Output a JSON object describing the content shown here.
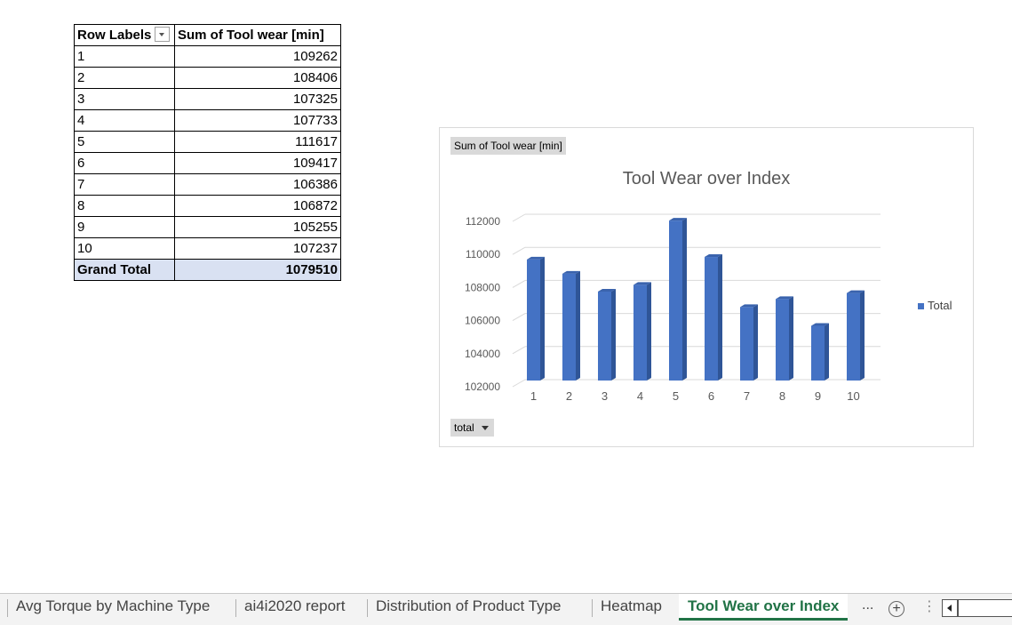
{
  "pivot": {
    "header_row_labels": "Row Labels",
    "header_sum": "Sum of Tool wear [min]",
    "rows": [
      {
        "label": "1",
        "value": "109262"
      },
      {
        "label": "2",
        "value": "108406"
      },
      {
        "label": "3",
        "value": "107325"
      },
      {
        "label": "4",
        "value": "107733"
      },
      {
        "label": "5",
        "value": "111617"
      },
      {
        "label": "6",
        "value": "109417"
      },
      {
        "label": "7",
        "value": "106386"
      },
      {
        "label": "8",
        "value": "106872"
      },
      {
        "label": "9",
        "value": "105255"
      },
      {
        "label": "10",
        "value": "107237"
      }
    ],
    "grand_total_label": "Grand Total",
    "grand_total_value": "1079510"
  },
  "chart": {
    "value_field_button": "Sum of Tool wear [min]",
    "axis_field_button": "total",
    "legend_label": "Total"
  },
  "chart_data": {
    "type": "bar",
    "title": "Tool Wear over Index",
    "categories": [
      "1",
      "2",
      "3",
      "4",
      "5",
      "6",
      "7",
      "8",
      "9",
      "10"
    ],
    "series": [
      {
        "name": "Total",
        "values": [
          109262,
          108406,
          107325,
          107733,
          111617,
          109417,
          106386,
          106872,
          105255,
          107237
        ]
      }
    ],
    "yticks": [
      "102000",
      "104000",
      "106000",
      "108000",
      "110000",
      "112000"
    ],
    "ylim": [
      102000,
      112000
    ],
    "grid": true,
    "legend_position": "right",
    "color": "#4472c4"
  },
  "tabs": {
    "items": [
      {
        "label": "Avg Torque by Machine Type"
      },
      {
        "label": "ai4i2020 report"
      },
      {
        "label": "Distribution of Product Type"
      },
      {
        "label": "Heatmap"
      },
      {
        "label": "Tool Wear over Index"
      }
    ],
    "overflow": "..."
  }
}
